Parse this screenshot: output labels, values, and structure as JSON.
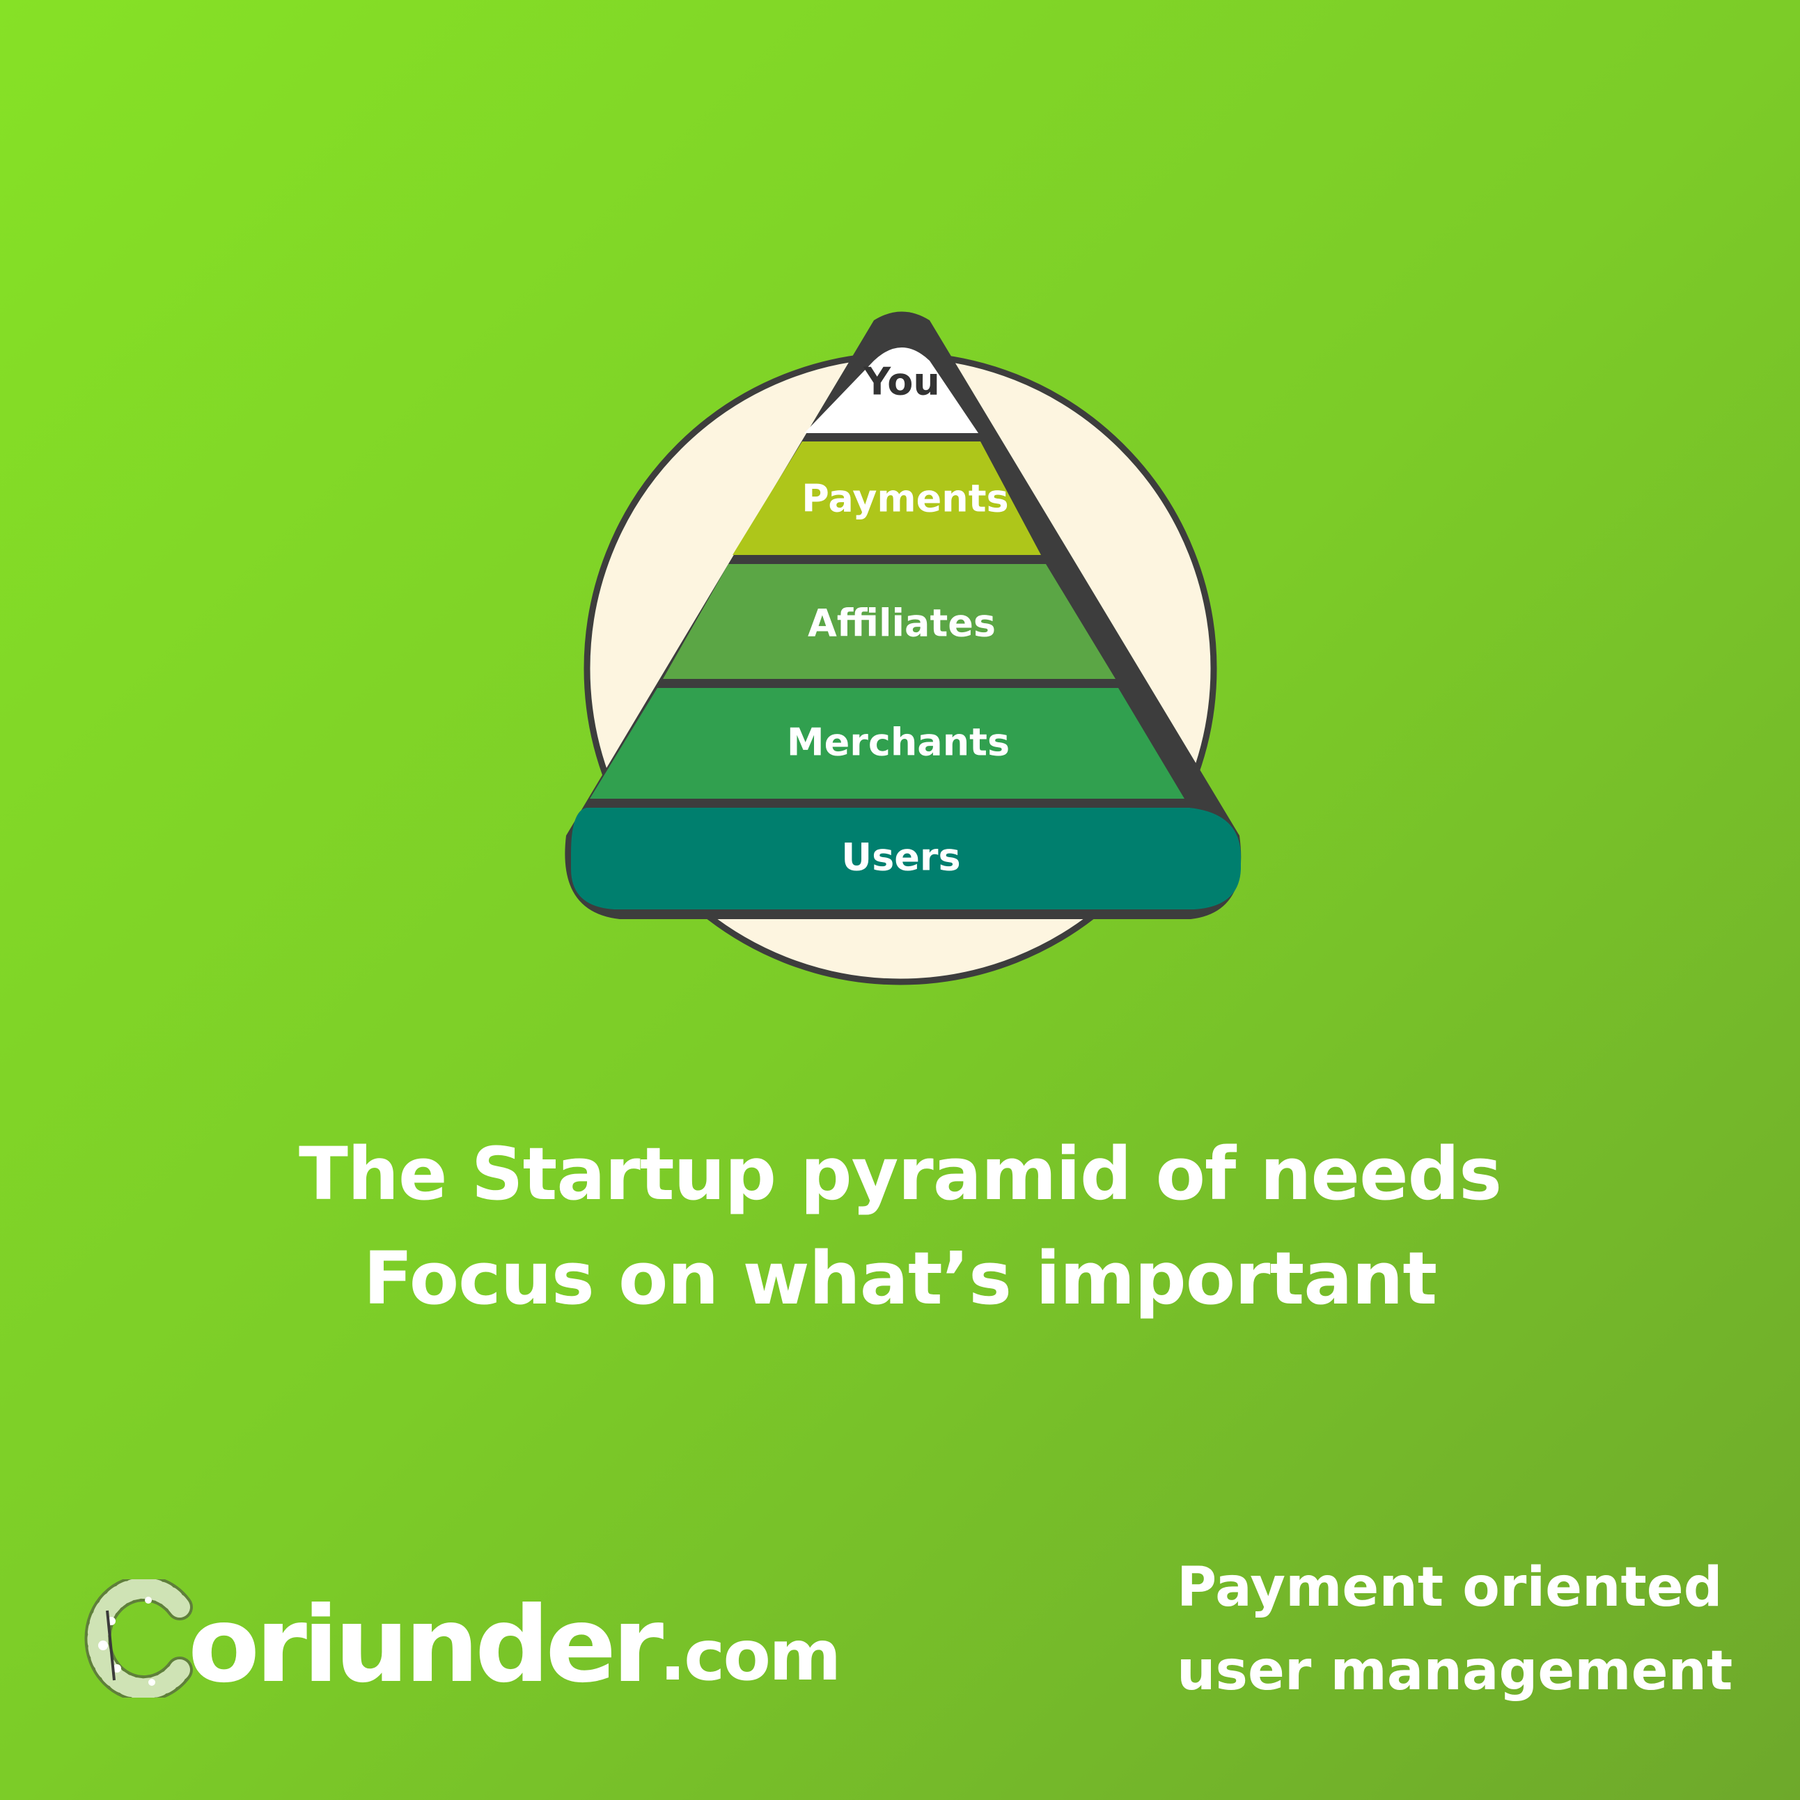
{
  "pyramid": {
    "layers": [
      {
        "label": "You",
        "fill": "#ffffff",
        "text_color": "#333333"
      },
      {
        "label": "Payments",
        "fill": "#aec61a",
        "text_color": "#ffffff"
      },
      {
        "label": "Affiliates",
        "fill": "#5ba645",
        "text_color": "#ffffff"
      },
      {
        "label": "Merchants",
        "fill": "#31a04f",
        "text_color": "#ffffff"
      },
      {
        "label": "Users",
        "fill": "#007f6e",
        "text_color": "#ffffff"
      }
    ],
    "circle_fill": "#fdf5e0",
    "outline_color": "#3d3d3d"
  },
  "caption": {
    "line1": "The Startup pyramid of needs",
    "line2": "Focus on what’s important"
  },
  "brand": {
    "name": "Coriunder",
    "name_visible": "oriunder",
    "suffix": ".com"
  },
  "tagline": {
    "line1": "Payment oriented",
    "line2": "user management"
  }
}
